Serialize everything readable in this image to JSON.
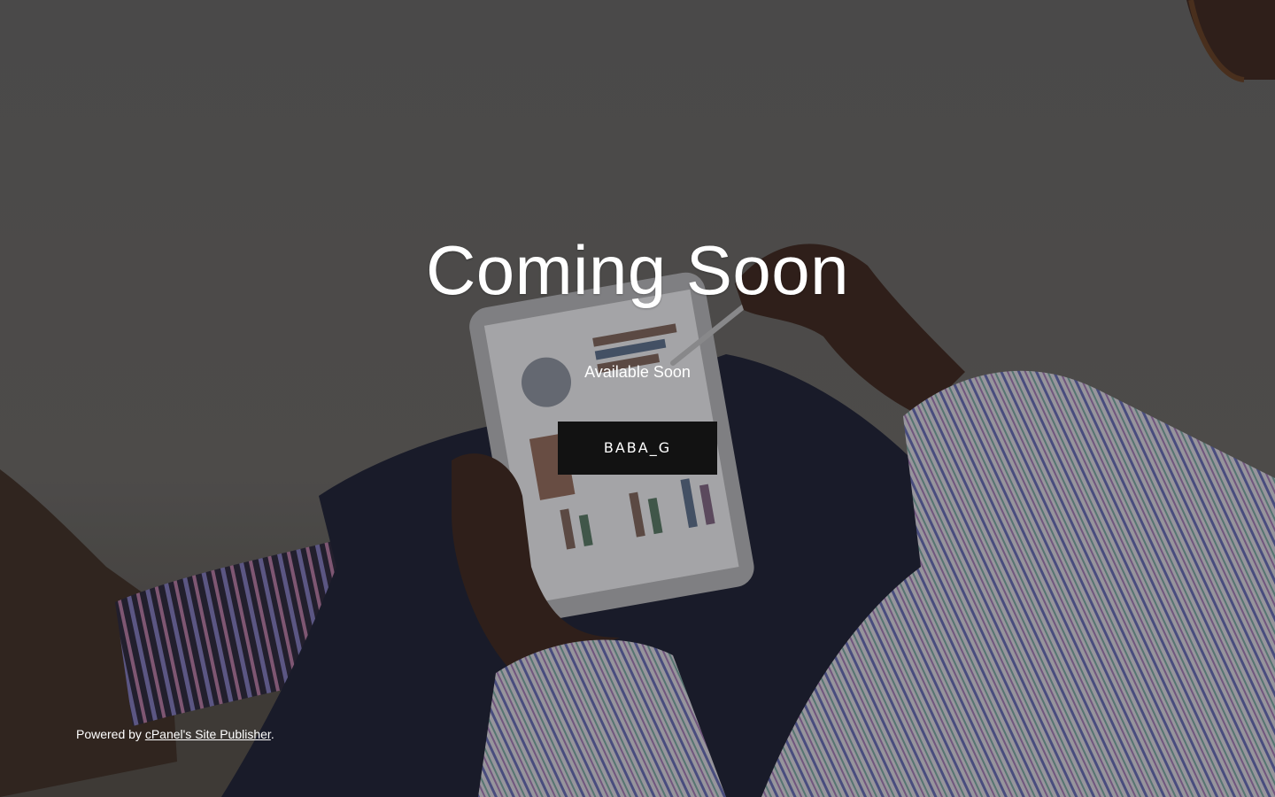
{
  "hero": {
    "title": "Coming Soon",
    "subtitle": "Available Soon",
    "button_label": "BABA_G"
  },
  "footer": {
    "prefix": "Powered by ",
    "link_label": "cPanel's Site Publisher",
    "suffix": "."
  },
  "colors": {
    "button_bg": "#121212",
    "text": "#ffffff",
    "overlay": "#000000"
  }
}
